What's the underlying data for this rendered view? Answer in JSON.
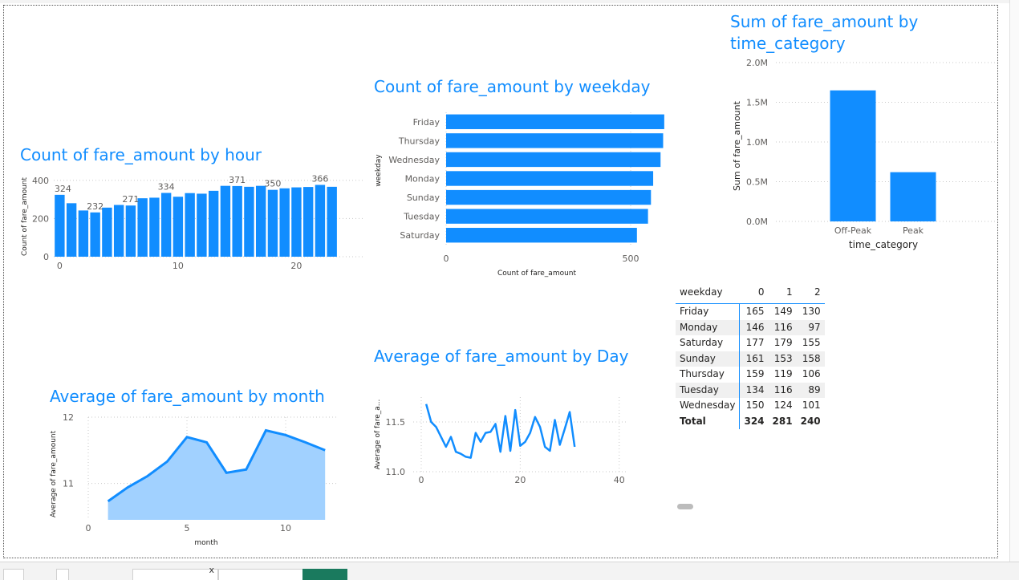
{
  "charts": [
    {
      "id": "hour",
      "type": "bar",
      "title": "Count of fare_amount by hour",
      "ylabel": "Count of fare_amount",
      "xlabel": "",
      "x": [
        0,
        1,
        2,
        3,
        4,
        5,
        6,
        7,
        8,
        9,
        10,
        11,
        12,
        13,
        14,
        15,
        16,
        17,
        18,
        19,
        20,
        21,
        22,
        23
      ],
      "values": [
        324,
        280,
        242,
        232,
        257,
        271,
        268,
        306,
        309,
        334,
        314,
        333,
        330,
        345,
        371,
        370,
        366,
        371,
        350,
        358,
        363,
        365,
        376,
        366
      ],
      "data_labels": {
        "0": "324",
        "3": "232",
        "6": "271",
        "9": "334",
        "15": "371",
        "18": "350",
        "22": "366"
      },
      "yticks": [
        "0",
        "200",
        "400"
      ],
      "ylim": [
        0,
        420
      ],
      "xticks": [
        "0",
        "10",
        "20"
      ],
      "color": "#118DFF"
    },
    {
      "id": "weekday",
      "type": "bar",
      "orientation": "horizontal",
      "title": "Count of fare_amount by weekday",
      "ylabel": "weekday",
      "xlabel": "Count of fare_amount",
      "categories": [
        "Friday",
        "Thursday",
        "Wednesday",
        "Monday",
        "Sunday",
        "Tuesday",
        "Saturday"
      ],
      "values": [
        591,
        588,
        581,
        561,
        555,
        547,
        517
      ],
      "xticks": [
        "0",
        "500"
      ],
      "xlim": [
        0,
        600
      ],
      "color": "#118DFF"
    },
    {
      "id": "time_category",
      "type": "bar",
      "title": "Sum of fare_amount by time_category",
      "ylabel": "Sum of fare_amount",
      "xlabel": "time_category",
      "categories": [
        "Off-Peak",
        "Peak"
      ],
      "values": [
        1.65,
        0.62
      ],
      "yticks": [
        "0.0M",
        "0.5M",
        "1.0M",
        "1.5M",
        "2.0M"
      ],
      "ylim": [
        0,
        2.0
      ],
      "color": "#118DFF"
    },
    {
      "id": "month",
      "type": "area",
      "title": "Average of fare_amount by month",
      "ylabel": "Average of fare_amount",
      "xlabel": "month",
      "x": [
        1,
        2,
        3,
        4,
        5,
        6,
        7,
        8,
        9,
        10,
        11,
        12
      ],
      "values": [
        10.73,
        10.94,
        11.11,
        11.33,
        11.7,
        11.62,
        11.16,
        11.21,
        11.8,
        11.73,
        11.62,
        11.5
      ],
      "yticks": [
        "11",
        "12"
      ],
      "ylim": [
        10.45,
        12.0
      ],
      "xticks": [
        "0",
        "5",
        "10"
      ],
      "color": "#118DFF",
      "fill": "#A1D1FF"
    },
    {
      "id": "day",
      "type": "line",
      "title": "Average of fare_amount by Day",
      "ylabel": "Average of fare_a...",
      "xlabel": "",
      "x": [
        1,
        2,
        3,
        4,
        5,
        6,
        7,
        8,
        9,
        10,
        11,
        12,
        13,
        14,
        15,
        16,
        17,
        18,
        19,
        20,
        21,
        22,
        23,
        24,
        25,
        26,
        27,
        28,
        29,
        30,
        31
      ],
      "values": [
        11.68,
        11.5,
        11.45,
        11.35,
        11.25,
        11.35,
        11.2,
        11.18,
        11.15,
        11.14,
        11.39,
        11.3,
        11.39,
        11.4,
        11.48,
        11.2,
        11.56,
        11.21,
        11.62,
        11.26,
        11.3,
        11.39,
        11.55,
        11.45,
        11.25,
        11.21,
        11.52,
        11.27,
        11.43,
        11.6,
        11.25
      ],
      "yticks": [
        "11.0",
        "11.5"
      ],
      "ylim": [
        11.0,
        11.75
      ],
      "xticks": [
        "0",
        "20",
        "40"
      ],
      "xlim": [
        0,
        40
      ],
      "color": "#118DFF"
    }
  ],
  "matrix": {
    "corner": "weekday",
    "columns": [
      "0",
      "1",
      "2"
    ],
    "rows": [
      {
        "label": "Friday",
        "values": [
          "165",
          "149",
          "130"
        ]
      },
      {
        "label": "Monday",
        "values": [
          "146",
          "116",
          "97"
        ]
      },
      {
        "label": "Saturday",
        "values": [
          "177",
          "179",
          "155"
        ]
      },
      {
        "label": "Sunday",
        "values": [
          "161",
          "153",
          "158"
        ]
      },
      {
        "label": "Thursday",
        "values": [
          "159",
          "119",
          "106"
        ]
      },
      {
        "label": "Tuesday",
        "values": [
          "134",
          "116",
          "89"
        ]
      },
      {
        "label": "Wednesday",
        "values": [
          "150",
          "124",
          "101"
        ]
      }
    ],
    "total": {
      "label": "Total",
      "values": [
        "324",
        "281",
        "240"
      ]
    }
  },
  "bottom_tab_close_label": "x"
}
